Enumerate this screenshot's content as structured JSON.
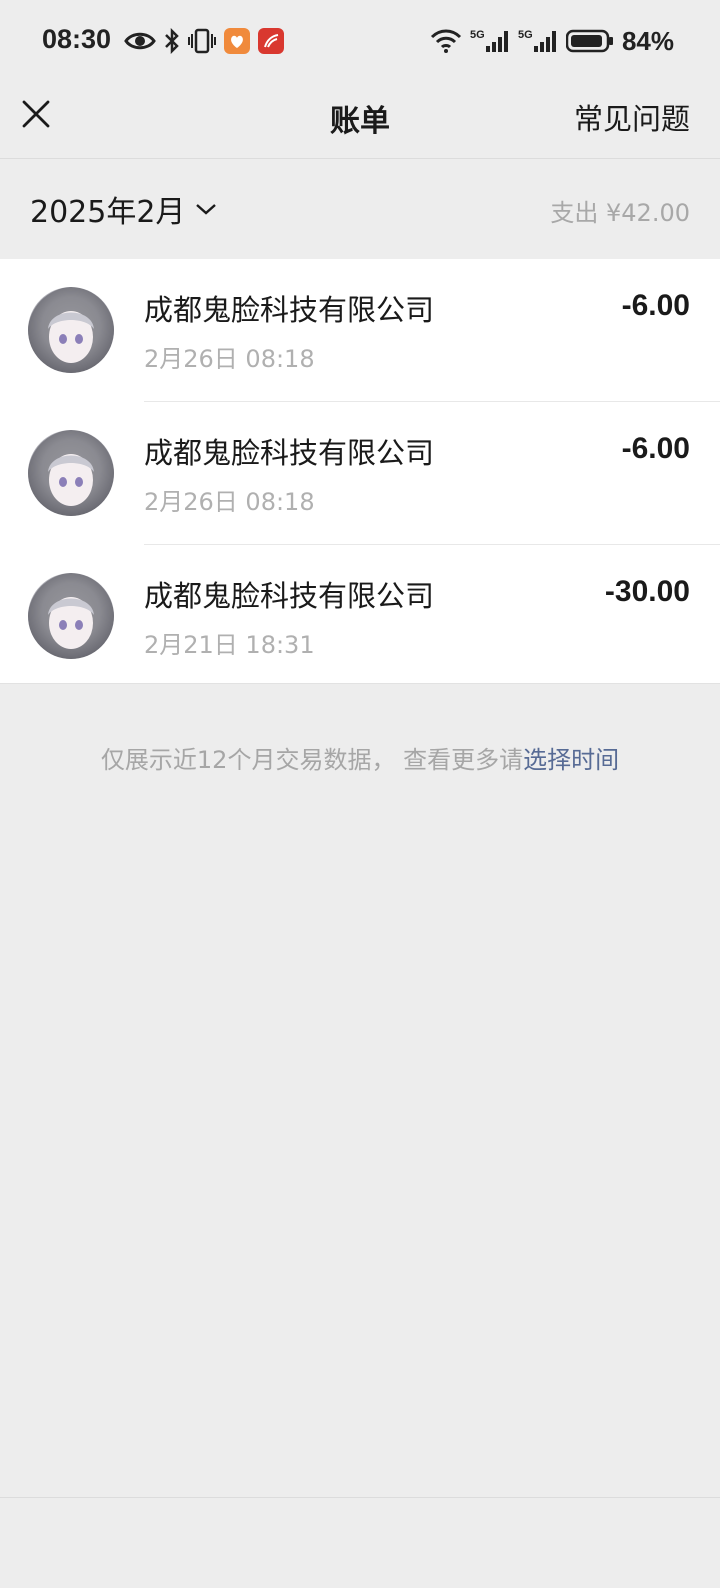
{
  "status_bar": {
    "time": "08:30",
    "battery": "84%",
    "left_icons": [
      "eye-icon",
      "bluetooth-icon",
      "vibrate-icon",
      "app-badge-orange-icon",
      "app-badge-red-icon"
    ],
    "right_icons": [
      "wifi-icon",
      "signal-5g-icon",
      "signal-5g-icon",
      "battery-icon"
    ]
  },
  "nav": {
    "title": "账单",
    "faq_label": "常见问题",
    "close_icon": "close-icon"
  },
  "summary": {
    "month": "2025年2月",
    "total": "支出 ¥42.00"
  },
  "transactions": [
    {
      "name": "成都鬼脸科技有限公司",
      "time": "2月26日 08:18",
      "amount": "-6.00"
    },
    {
      "name": "成都鬼脸科技有限公司",
      "time": "2月26日 08:18",
      "amount": "-6.00"
    },
    {
      "name": "成都鬼脸科技有限公司",
      "time": "2月21日 18:31",
      "amount": "-30.00"
    }
  ],
  "footer": {
    "note": "仅展示近12个月交易数据， 查看更多请",
    "link": "选择时间"
  },
  "colors": {
    "background": "#ededed",
    "card": "#ffffff",
    "link": "#576b95",
    "muted": "#a6a6a6"
  }
}
